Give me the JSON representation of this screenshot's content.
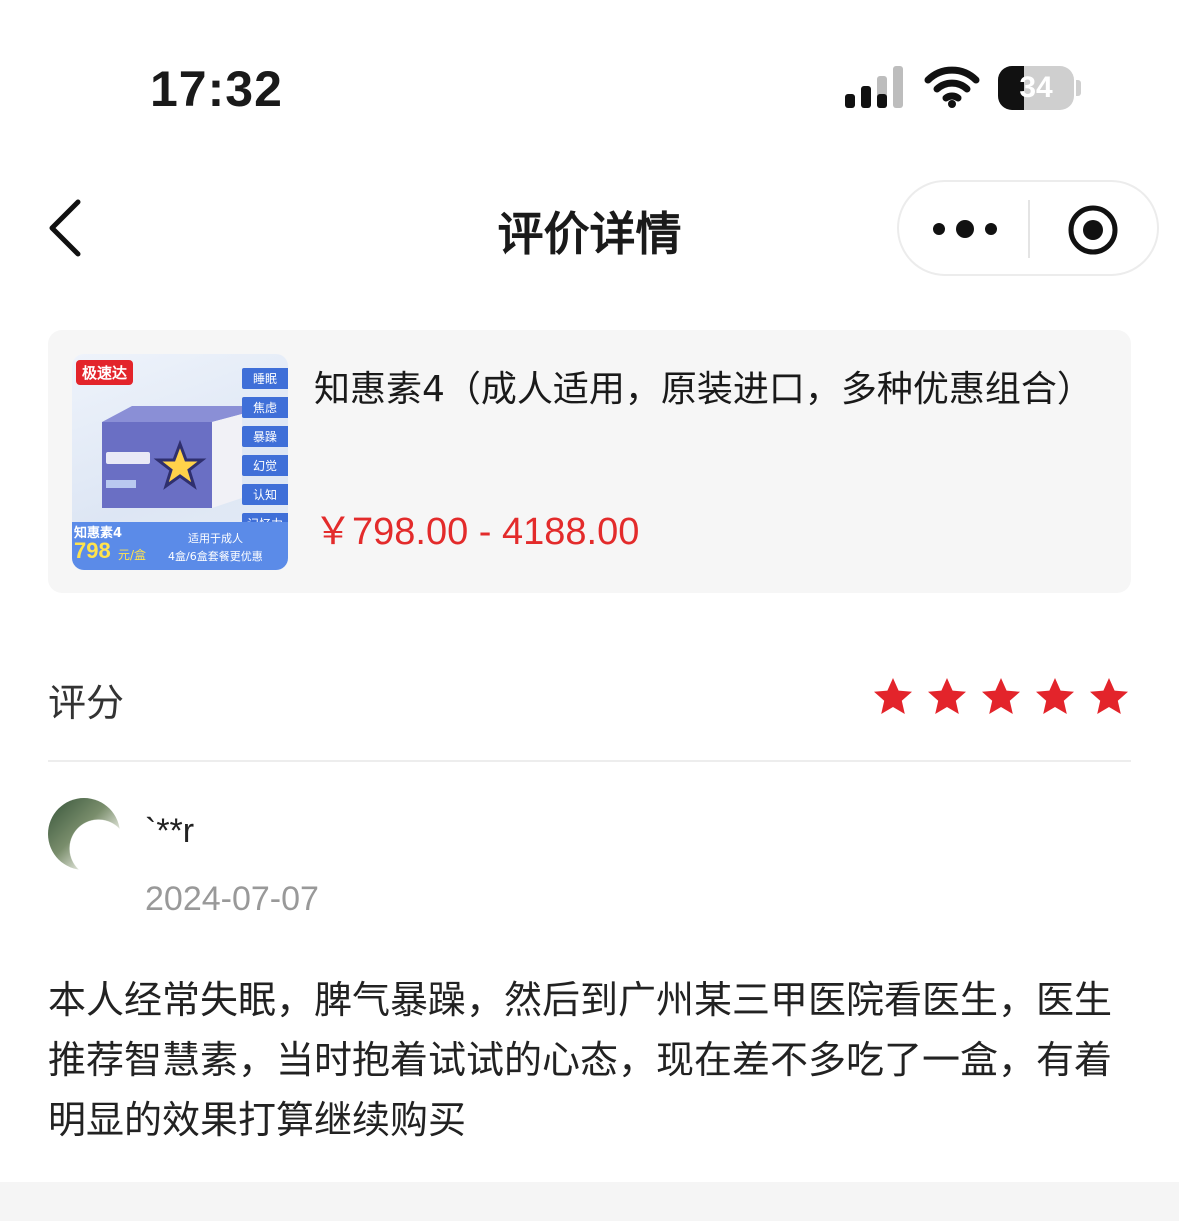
{
  "status_bar": {
    "time": "17:32",
    "battery_level": "34",
    "battery_fraction": 0.34,
    "icons": [
      "cellular-signal-icon",
      "wifi-icon",
      "battery-icon"
    ]
  },
  "nav": {
    "title": "评价详情",
    "icons": [
      "back-icon",
      "more-icon",
      "close-mini-program-icon"
    ]
  },
  "product": {
    "title": "知惠素4（成人适用，原装进口，多种优惠组合）",
    "price": "￥798.00 - 4188.00",
    "image": {
      "badge": "极速达",
      "tags": [
        "睡眠",
        "焦虑",
        "暴躁",
        "幻觉",
        "认知",
        "记忆力"
      ],
      "name": "知惠素4",
      "price": "798",
      "price_unit": "元/盒",
      "note_line1": "适用于成人",
      "note_line2": "4盒/6盒套餐更优惠"
    }
  },
  "rating": {
    "label": "评分",
    "stars": 5,
    "max_stars": 5,
    "star_color": "#e3242b"
  },
  "review": {
    "reviewer": "`**r",
    "date": "2024-07-07",
    "content": "本人经常失眠，脾气暴躁，然后到广州某三甲医院看医生，医生推荐智慧素，当时抱着试试的心态，现在差不多吃了一盒，有着明显的效果打算继续购买"
  },
  "colors": {
    "price": "#e32b2b",
    "card_bg": "#f6f6f6",
    "date_gray": "#999999"
  }
}
